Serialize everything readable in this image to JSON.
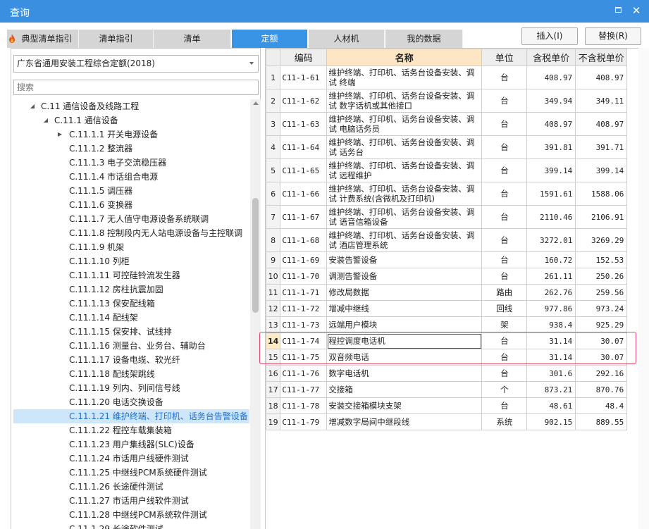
{
  "window": {
    "title": "查询",
    "max_icon": "maximize-icon",
    "close_glyph": "✕"
  },
  "tabs": [
    {
      "label": "典型清单指引",
      "icon": "fire-icon"
    },
    {
      "label": "清单指引"
    },
    {
      "label": "清单"
    },
    {
      "label": "定额",
      "active": true
    },
    {
      "label": "人材机"
    },
    {
      "label": "我的数据"
    }
  ],
  "actions": {
    "insert_label": "插入(I)",
    "replace_label": "替换(R)"
  },
  "library": {
    "selected": "广东省通用安装工程综合定额(2018)"
  },
  "search": {
    "placeholder": "搜索",
    "value": ""
  },
  "tree": [
    {
      "label": "C.11 通信设备及线路工程",
      "level": 0,
      "expanded": true
    },
    {
      "label": "C.11.1 通信设备",
      "level": 1,
      "expanded": true
    },
    {
      "label": "C.11.1.1 开关电源设备",
      "level": 2,
      "expanded": false
    },
    {
      "label": "C.11.1.2 整流器",
      "level": 2
    },
    {
      "label": "C.11.1.3 电子交流稳压器",
      "level": 2
    },
    {
      "label": "C.11.1.4 市话组合电源",
      "level": 2
    },
    {
      "label": "C.11.1.5 调压器",
      "level": 2
    },
    {
      "label": "C.11.1.6 变换器",
      "level": 2
    },
    {
      "label": "C.11.1.7 无人值守电源设备系统联调",
      "level": 2
    },
    {
      "label": "C.11.1.8 控制段内无人站电源设备与主控联调",
      "level": 2
    },
    {
      "label": "C.11.1.9 机架",
      "level": 2
    },
    {
      "label": "C.11.1.10 列柜",
      "level": 2
    },
    {
      "label": "C.11.1.11 可控硅铃流发生器",
      "level": 2
    },
    {
      "label": "C.11.1.12 房柱抗震加固",
      "level": 2
    },
    {
      "label": "C.11.1.13 保安配线箱",
      "level": 2
    },
    {
      "label": "C.11.1.14 配线架",
      "level": 2
    },
    {
      "label": "C.11.1.15 保安排、试线排",
      "level": 2
    },
    {
      "label": "C.11.1.16 测量台、业务台、辅助台",
      "level": 2
    },
    {
      "label": "C.11.1.17 设备电缆、软光纤",
      "level": 2
    },
    {
      "label": "C.11.1.18 配线架跳线",
      "level": 2
    },
    {
      "label": "C.11.1.19 列内、列间信号线",
      "level": 2
    },
    {
      "label": "C.11.1.20 电话交换设备",
      "level": 2
    },
    {
      "label": "C.11.1.21 维护终端、打印机、话务台告警设备",
      "level": 2,
      "selected": true
    },
    {
      "label": "C.11.1.22 程控车载集装箱",
      "level": 2
    },
    {
      "label": "C.11.1.23 用户集线器(SLC)设备",
      "level": 2
    },
    {
      "label": "C.11.1.24 市话用户线硬件测试",
      "level": 2
    },
    {
      "label": "C.11.1.25 中继线PCM系统硬件测试",
      "level": 2
    },
    {
      "label": "C.11.1.26 长途硬件测试",
      "level": 2
    },
    {
      "label": "C.11.1.27 市话用户线软件测试",
      "level": 2
    },
    {
      "label": "C.11.1.28 中继线PCM系统软件测试",
      "level": 2
    },
    {
      "label": "C.11.1.29 长途软件测试",
      "level": 2
    }
  ],
  "table": {
    "headers": [
      "",
      "编码",
      "名称",
      "单位",
      "含税单价",
      "不含税单价"
    ],
    "current_row": 14,
    "highlight_rows": [
      14,
      15
    ],
    "rows": [
      {
        "no": "1",
        "code": "C11-1-61",
        "name": "维护终端、打印机、话务台设备安装、调试 终端",
        "unit": "台",
        "tax": "408.97",
        "notax": "408.97",
        "tall": true
      },
      {
        "no": "2",
        "code": "C11-1-62",
        "name": "维护终端、打印机、话务台设备安装、调试 数字话机或其他接口",
        "unit": "台",
        "tax": "349.94",
        "notax": "349.11",
        "tall": true
      },
      {
        "no": "3",
        "code": "C11-1-63",
        "name": "维护终端、打印机、话务台设备安装、调试 电脑话务员",
        "unit": "台",
        "tax": "408.97",
        "notax": "408.97",
        "tall": true
      },
      {
        "no": "4",
        "code": "C11-1-64",
        "name": "维护终端、打印机、话务台设备安装、调试 话务台",
        "unit": "台",
        "tax": "391.81",
        "notax": "391.71",
        "tall": true
      },
      {
        "no": "5",
        "code": "C11-1-65",
        "name": "维护终端、打印机、话务台设备安装、调试 远程维护",
        "unit": "台",
        "tax": "399.14",
        "notax": "399.14",
        "tall": true
      },
      {
        "no": "6",
        "code": "C11-1-66",
        "name": "维护终端、打印机、话务台设备安装、调试 计费系统(含微机及打印机)",
        "unit": "台",
        "tax": "1591.61",
        "notax": "1588.06",
        "tall": true
      },
      {
        "no": "7",
        "code": "C11-1-67",
        "name": "维护终端、打印机、话务台设备安装、调试 语音信箱设备",
        "unit": "台",
        "tax": "2110.46",
        "notax": "2106.91",
        "tall": true
      },
      {
        "no": "8",
        "code": "C11-1-68",
        "name": "维护终端、打印机、话务台设备安装、调试 酒店管理系统",
        "unit": "台",
        "tax": "3272.01",
        "notax": "3269.29",
        "tall": true
      },
      {
        "no": "9",
        "code": "C11-1-69",
        "name": "安装告警设备",
        "unit": "台",
        "tax": "160.72",
        "notax": "152.53"
      },
      {
        "no": "10",
        "code": "C11-1-70",
        "name": "调测告警设备",
        "unit": "台",
        "tax": "261.11",
        "notax": "250.26"
      },
      {
        "no": "11",
        "code": "C11-1-71",
        "name": "修改局数据",
        "unit": "路由",
        "tax": "262.76",
        "notax": "259.56"
      },
      {
        "no": "12",
        "code": "C11-1-72",
        "name": "增减中继线",
        "unit": "回线",
        "tax": "977.86",
        "notax": "973.24"
      },
      {
        "no": "13",
        "code": "C11-1-73",
        "name": "远端用户模块",
        "unit": "架",
        "tax": "938.4",
        "notax": "925.29"
      },
      {
        "no": "14",
        "code": "C11-1-74",
        "name": "程控调度电话机",
        "unit": "台",
        "tax": "31.14",
        "notax": "30.07"
      },
      {
        "no": "15",
        "code": "C11-1-75",
        "name": "双音频电话",
        "unit": "台",
        "tax": "31.14",
        "notax": "30.07"
      },
      {
        "no": "16",
        "code": "C11-1-76",
        "name": "数字电话机",
        "unit": "台",
        "tax": "301.6",
        "notax": "292.16"
      },
      {
        "no": "17",
        "code": "C11-1-77",
        "name": "交接箱",
        "unit": "个",
        "tax": "873.21",
        "notax": "870.76"
      },
      {
        "no": "18",
        "code": "C11-1-78",
        "name": "安装交接箱模块支架",
        "unit": "台",
        "tax": "48.61",
        "notax": "48.4"
      },
      {
        "no": "19",
        "code": "C11-1-79",
        "name": "增减数字局间中继段线",
        "unit": "系统",
        "tax": "902.15",
        "notax": "889.55"
      }
    ]
  },
  "colors": {
    "titlebar": "#3a8fe0",
    "active_tab": "#3a94e6",
    "selection": "#cde6fa",
    "name_header": "#fde6c4",
    "highlight_box": "#e24a6a"
  }
}
